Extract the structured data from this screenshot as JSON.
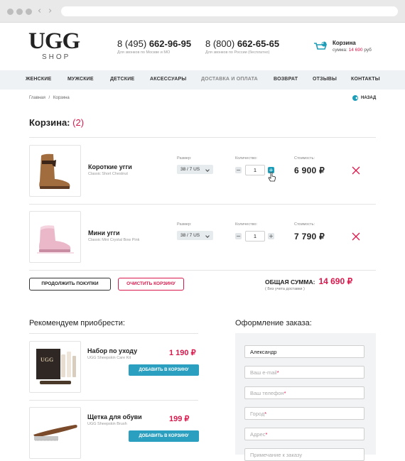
{
  "header": {
    "logo_text": "UGG",
    "logo_sub": "SHOP",
    "phone1": {
      "code": "8 (495)",
      "number": "662-96-95",
      "note": "Для звонков по Москве и МО"
    },
    "phone2": {
      "code": "8 (800)",
      "number": "662-65-65",
      "note": "Для звонков по России (бесплатно)"
    },
    "cart": {
      "title": "Корзина",
      "sum_label": "сумма:",
      "sum_value": "14 690",
      "currency": "руб",
      "count": "2"
    }
  },
  "menu": [
    "ЖЕНСКИЕ",
    "МУЖСКИЕ",
    "ДЕТСКИЕ",
    "АКСЕССУАРЫ",
    "ДОСТАВКА И ОПЛАТА",
    "ВОЗВРАТ",
    "ОТЗЫВЫ",
    "КОНТАКТЫ"
  ],
  "breadcrumb": {
    "home": "Главная",
    "sep": "/",
    "current": "Корзина"
  },
  "back_label": "НАЗАД",
  "cart": {
    "title": "Корзина:",
    "count": "(2)",
    "labels": {
      "size": "Размер:",
      "qty": "Количество:",
      "cost": "Стоимость:"
    },
    "items": [
      {
        "name": "Короткие угги",
        "sub": "Classic Short Chestnut",
        "size": "38 / 7 US",
        "qty": "1",
        "price": "6 900 ₽"
      },
      {
        "name": "Мини угги",
        "sub": "Classic Mini Crystal Bow Pink",
        "size": "38 / 7 US",
        "qty": "1",
        "price": "7 790 ₽"
      }
    ],
    "continue_label": "ПРОДОЛЖИТЬ ПОКУПКИ",
    "clear_label": "ОЧИСТИТЬ КОРЗИНУ",
    "total_label": "ОБЩАЯ СУММА:",
    "total_value": "14 690 ₽",
    "total_note": "( Без учета доставки )"
  },
  "recommend": {
    "title": "Рекомендуем приобрести:",
    "items": [
      {
        "name": "Набор по уходу",
        "sub": "UGG Sheepskin Care Kit",
        "price": "1 190 ₽",
        "button": "ДОБАВИТЬ В КОРЗИНУ"
      },
      {
        "name": "Щетка для обуви",
        "sub": "UGG Sheepskin Brush",
        "price": "199 ₽",
        "button": "ДОБАВИТЬ В КОРЗИНУ"
      }
    ]
  },
  "order": {
    "title": "Оформление заказа:",
    "name_value": "Александр",
    "email_ph": "Ваш e-mail",
    "phone_ph": "Ваш телефон",
    "city_ph": "Город",
    "address_ph": "Адрес",
    "comment_ph": "Примечание к заказу",
    "required_mark": "*"
  },
  "colors": {
    "accent": "#1e9db8",
    "brand_pink": "#d9194c",
    "menu_bg": "#eef2f5",
    "form_bg": "#f1f3f4"
  }
}
